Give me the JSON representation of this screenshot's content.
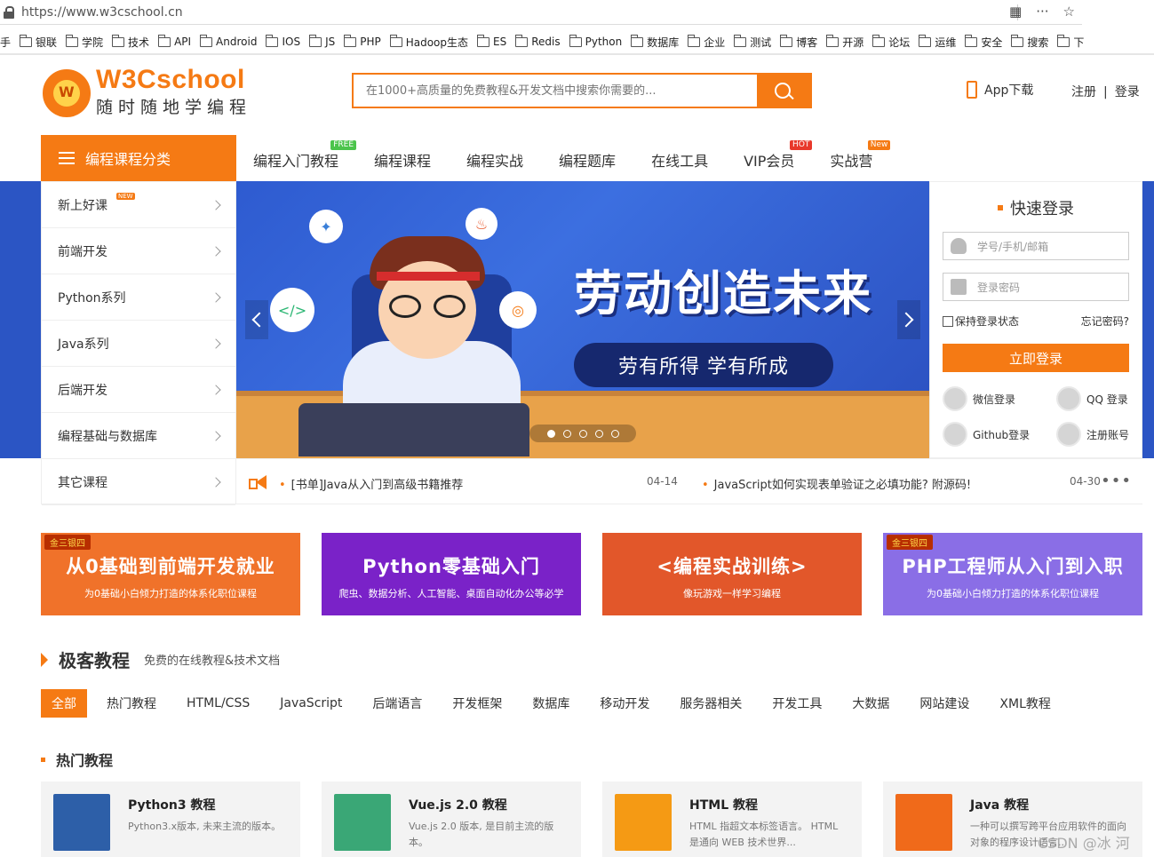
{
  "browser": {
    "url": "https://www.w3cschool.cn",
    "bookmarks": [
      "手",
      "银联",
      "学院",
      "技术",
      "API",
      "Android",
      "IOS",
      "JS",
      "PHP",
      "Hadoop生态",
      "ES",
      "Redis",
      "Python",
      "数据库",
      "企业",
      "测试",
      "博客",
      "开源",
      "论坛",
      "运维",
      "安全",
      "搜索",
      "下"
    ]
  },
  "header": {
    "logo_main": "W3Cschool",
    "logo_sub": "随时随地学编程",
    "search_placeholder": "在1000+高质量的免费教程&开发文档中搜索你需要的...",
    "app_download": "App下载",
    "register": "注册",
    "separator": "|",
    "login": "登录"
  },
  "nav": {
    "category_button": "编程课程分类",
    "items": [
      {
        "label": "编程入门教程",
        "badge": "FREE",
        "badge_color": "#4cc44c"
      },
      {
        "label": "编程课程",
        "badge": "",
        "badge_color": ""
      },
      {
        "label": "编程实战",
        "badge": "",
        "badge_color": ""
      },
      {
        "label": "编程题库",
        "badge": "",
        "badge_color": ""
      },
      {
        "label": "在线工具",
        "badge": "",
        "badge_color": ""
      },
      {
        "label": "VIP会员",
        "badge": "HOT",
        "badge_color": "#e8382b"
      },
      {
        "label": "实战营",
        "badge": "New",
        "badge_color": "#f57a14"
      }
    ]
  },
  "sidebar": {
    "items": [
      "新上好课",
      "前端开发",
      "Python系列",
      "Java系列",
      "后端开发",
      "编程基础与数据库",
      "其它课程"
    ],
    "new_badge": "NEW"
  },
  "banner": {
    "headline": "劳动创造未来",
    "subline": "劳有所得  学有所成"
  },
  "login": {
    "title": "快速登录",
    "username_placeholder": "学号/手机/邮箱",
    "password_placeholder": "登录密码",
    "remember": "保持登录状态",
    "forgot": "忘记密码?",
    "submit": "立即登录",
    "wechat": "微信登录",
    "qq": "QQ 登录",
    "github": "Github登录",
    "signup": "注册账号"
  },
  "notices": [
    {
      "text": "[书单]Java从入门到高级书籍推荐",
      "date": "04-14"
    },
    {
      "text": "JavaScript如何实现表单验证之必填功能? 附源码!",
      "date": "04-30"
    }
  ],
  "promos": [
    {
      "tag": "金三银四",
      "title": "从0基础到前端开发就业",
      "sub": "为0基础小白倾力打造的体系化职位课程",
      "color": "#f0722a"
    },
    {
      "tag": "",
      "title": "Python零基础入门",
      "sub": "爬虫、数据分析、人工智能、桌面自动化办公等必学",
      "color": "#7a22c8"
    },
    {
      "tag": "",
      "title": "<编程实战训练>",
      "sub": "像玩游戏一样学习编程",
      "color": "#e2572a"
    },
    {
      "tag": "金三银四",
      "title": "PHP工程师从入门到入职",
      "sub": "为0基础小白倾力打造的体系化职位课程",
      "color": "#8a6ee6"
    }
  ],
  "section": {
    "title": "极客教程",
    "subtitle": "免费的在线教程&技术文档",
    "tabs": [
      "全部",
      "热门教程",
      "HTML/CSS",
      "JavaScript",
      "后端语言",
      "开发框架",
      "数据库",
      "移动开发",
      "服务器相关",
      "开发工具",
      "大数据",
      "网站建设",
      "XML教程"
    ],
    "hot_title": "热门教程"
  },
  "cards": [
    {
      "title": "Python3 教程",
      "desc": "Python3.x版本, 未来主流的版本。",
      "icon": "python-icon",
      "color": "#2d5fa8"
    },
    {
      "title": "Vue.js 2.0 教程",
      "desc": "Vue.js 2.0 版本, 是目前主流的版本。",
      "icon": "vue-icon",
      "color": "#3aa776"
    },
    {
      "title": "HTML 教程",
      "desc": "HTML 指超文本标签语言。 HTML 是通向 WEB 技术世界...",
      "icon": "html-icon",
      "color": "#f59a14"
    },
    {
      "title": "Java 教程",
      "desc": "一种可以撰写跨平台应用软件的面向对象的程序设计语言...",
      "icon": "java-icon",
      "color": "#f06a1a"
    }
  ],
  "watermark": "CSDN @冰 河"
}
